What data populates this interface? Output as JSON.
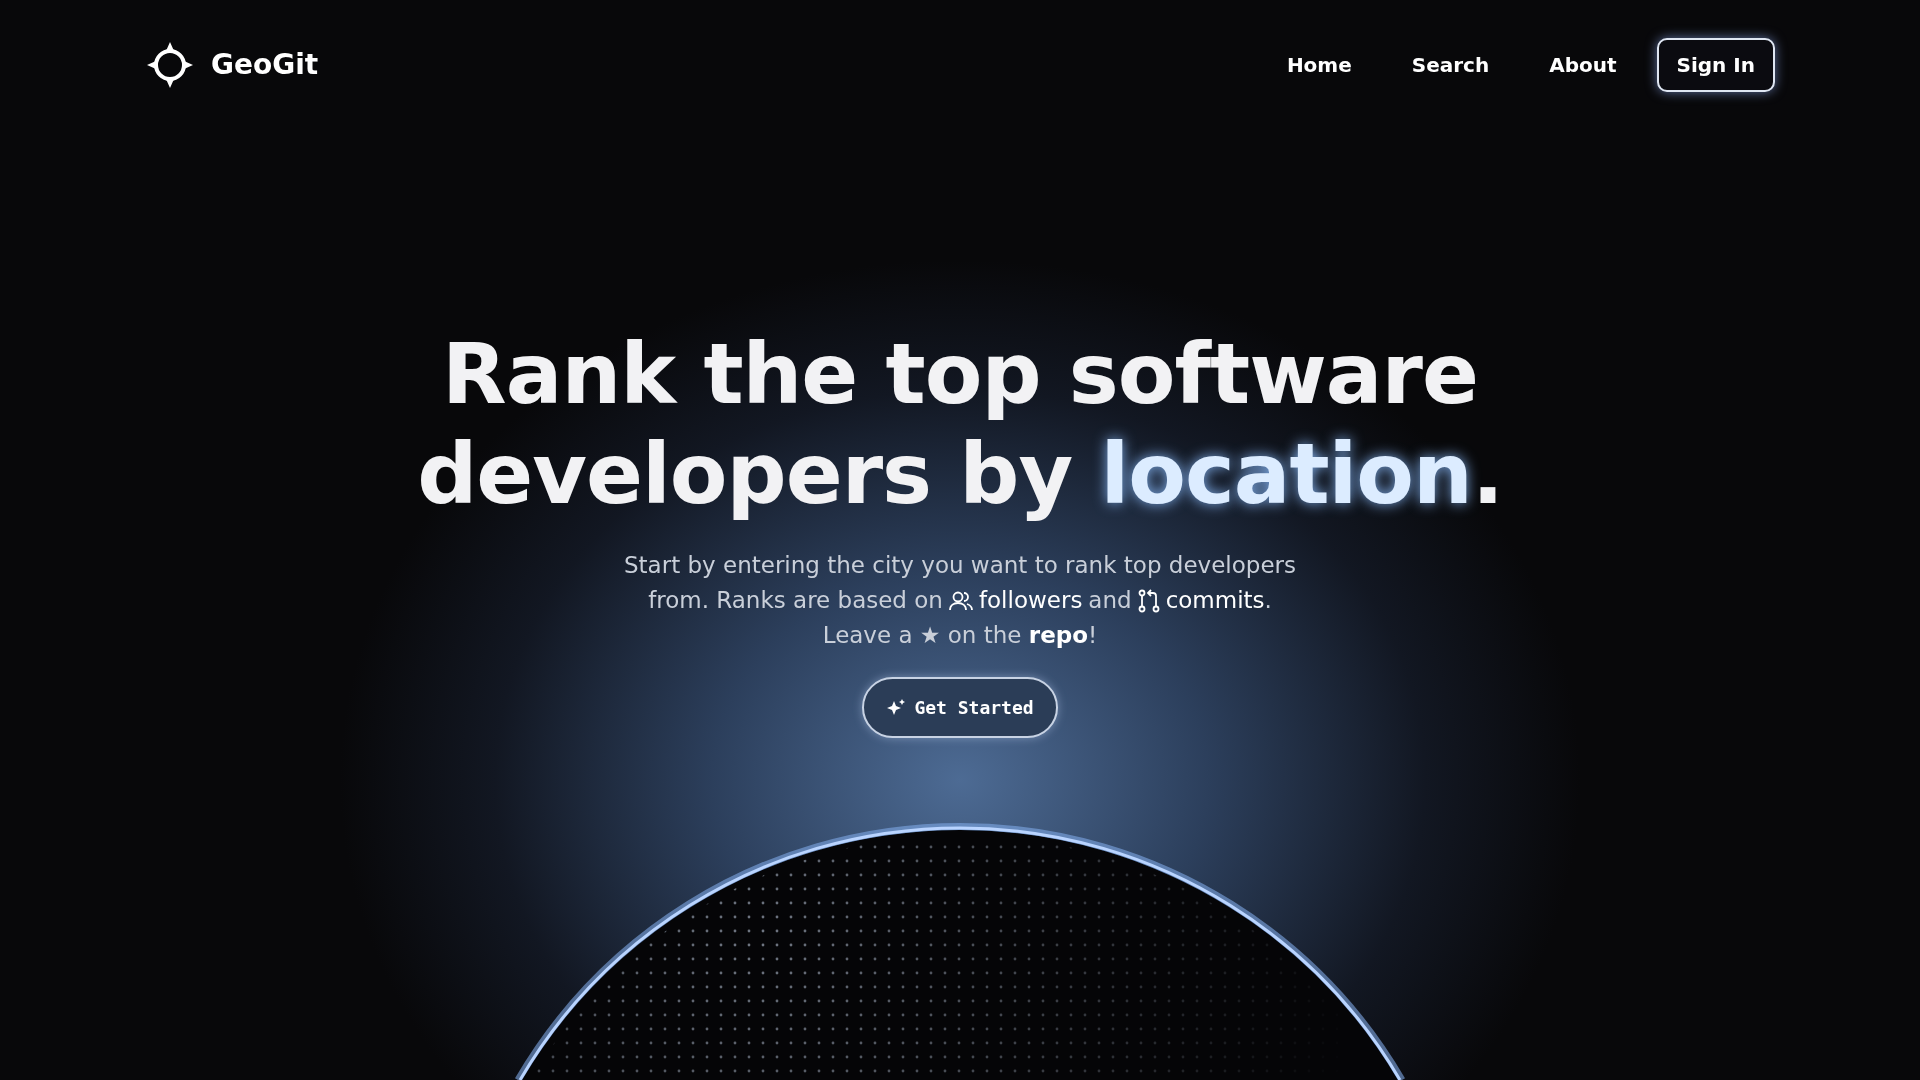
{
  "navbar": {
    "brand": "GeoGit",
    "links": [
      {
        "label": "Home"
      },
      {
        "label": "Search"
      },
      {
        "label": "About"
      }
    ],
    "sign_in": "Sign In"
  },
  "hero": {
    "heading": {
      "before": "Rank the top software developers by",
      "highlight": "location",
      "after": "."
    },
    "subtitle": {
      "line_1": "Start by entering the city you want to rank top developers",
      "line_2": {
        "lead": "from. Ranks are based on",
        "followers": "followers",
        "middle": "and",
        "commits": "commits",
        "end": "."
      },
      "line_3": "Leave a ★ on the **repo**!"
    },
    "button": "Get Started"
  }
}
